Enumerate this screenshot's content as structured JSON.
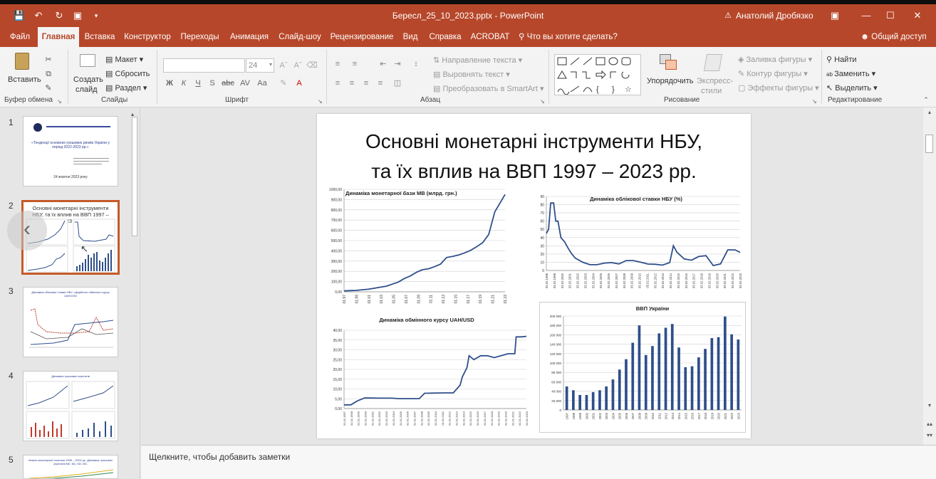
{
  "window": {
    "doc_title": "Бересл_25_10_2023.pptx - PowerPoint",
    "user": "Анатолий Дробязко"
  },
  "tabs": [
    {
      "label": "Файл"
    },
    {
      "label": "Главная"
    },
    {
      "label": "Вставка"
    },
    {
      "label": "Конструктор"
    },
    {
      "label": "Переходы"
    },
    {
      "label": "Анимация"
    },
    {
      "label": "Слайд-шоу"
    },
    {
      "label": "Рецензирование"
    },
    {
      "label": "Вид"
    },
    {
      "label": "Справка"
    },
    {
      "label": "ACROBAT"
    }
  ],
  "tell_me": "Что вы хотите сделать?",
  "share": "Общий доступ",
  "ribbon": {
    "clipboard": {
      "paste": "Вставить",
      "label": "Буфер обмена"
    },
    "slides": {
      "new_slide_1": "Создать",
      "new_slide_2": "слайд",
      "layout": "Макет",
      "reset": "Сбросить",
      "section": "Раздел",
      "label": "Слайды"
    },
    "font": {
      "font_name": "",
      "font_size": "24",
      "label": "Шрифт"
    },
    "paragraph": {
      "text_direction": "Направление текста",
      "align_text": "Выровнять текст",
      "smartart": "Преобразовать в SmartArt",
      "label": "Абзац"
    },
    "drawing": {
      "arrange_1": "Упорядочить",
      "styles_1": "Экспресс-",
      "styles_2": "стили",
      "fill": "Заливка фигуры",
      "outline": "Контур фигуры",
      "effects": "Эффекты фигуры",
      "label": "Рисование"
    },
    "editing": {
      "find": "Найти",
      "replace": "Заменить",
      "select": "Выделить",
      "label": "Редактирование"
    }
  },
  "slides_panel": [
    {
      "num": "1",
      "title": "«Тенденції основних грошових ринків України у період 2022-2023 рр.»",
      "date": "24 жовтня 2023 року"
    },
    {
      "num": "2",
      "title": "Основні монетарні інструменти НБУ, та їх вплив на ВВП 1997 – 2023 рр."
    },
    {
      "num": "3",
      "title": "Динаміка облікової ставки НБУ, офіційного обмінного курсу UAH/USD"
    },
    {
      "num": "4",
      "title": "Динаміка грошових агрегатів"
    },
    {
      "num": "5",
      "title": "Аналіз монетарної політики 1996 – 2023 рр. Динаміка грошових агрегатів M0, M1, M2, M3."
    }
  ],
  "slide": {
    "title_line1": "Основні монетарні інструменти НБУ,",
    "title_line2": "та їх вплив на ВВП 1997 – 2023 рр."
  },
  "notes_placeholder": "Щелкните, чтобы добавить заметки",
  "chart_data": [
    {
      "type": "line",
      "title": "Динаміка монетарної бази МВ (млрд. грн.)",
      "ylim": [
        0,
        1000
      ],
      "yticks": [
        "0,00",
        "100,00",
        "200,00",
        "300,00",
        "400,00",
        "500,00",
        "600,00",
        "700,00",
        "800,00",
        "900,00",
        "1000,00"
      ],
      "xticks": [
        "01.97",
        "01.99",
        "01.01",
        "01.03",
        "01.05",
        "01.07",
        "01.09",
        "01.11",
        "01.13",
        "01.15",
        "01.17",
        "01.19",
        "01.21",
        "01.23"
      ],
      "x": [
        1997,
        1998,
        1999,
        2000,
        2001,
        2002,
        2003,
        2004,
        2005,
        2006,
        2007,
        2008,
        2009,
        2010,
        2011,
        2012,
        2013,
        2014,
        2015,
        2016,
        2017,
        2018,
        2019,
        2020,
        2021,
        2022,
        2023,
        2023.7
      ],
      "y": [
        10,
        12,
        14,
        20,
        25,
        35,
        45,
        55,
        75,
        95,
        130,
        155,
        190,
        215,
        225,
        245,
        270,
        335,
        345,
        360,
        380,
        405,
        440,
        480,
        560,
        780,
        880,
        950
      ],
      "color": "#2f4f8a"
    },
    {
      "type": "line",
      "title": "Динаміка облікової ставки НБУ (%)",
      "ylim": [
        0,
        90
      ],
      "yticks": [
        "0",
        "10",
        "20",
        "30",
        "40",
        "50",
        "60",
        "70",
        "80",
        "90"
      ],
      "xticks": [
        "05.02.1998",
        "05.02.1999",
        "05.02.2000",
        "05.02.2001",
        "05.02.2002",
        "05.02.2003",
        "05.02.2004",
        "05.02.2005",
        "05.02.2006",
        "05.02.2007",
        "05.02.2008",
        "05.02.2009",
        "05.02.2010",
        "05.02.2011",
        "05.02.2012",
        "05.02.2013",
        "05.02.2014",
        "05.02.2015",
        "05.02.2016",
        "05.02.2017",
        "05.02.2018",
        "05.02.2019",
        "05.02.2020",
        "05.02.2021",
        "05.02.2022",
        "05.02.2023"
      ],
      "x": [
        1997,
        1997.3,
        1997.6,
        1998,
        1998.3,
        1998.6,
        1999,
        1999.5,
        2000,
        2000.5,
        2001,
        2002,
        2003,
        2004,
        2005,
        2006,
        2007,
        2008,
        2009,
        2010,
        2011,
        2012,
        2013,
        2014,
        2014.5,
        2015,
        2016,
        2017,
        2018,
        2019,
        2020,
        2021,
        2022,
        2023,
        2023.7
      ],
      "y": [
        45,
        50,
        82,
        82,
        60,
        60,
        40,
        35,
        27,
        20,
        15,
        10,
        7,
        7,
        9,
        9.5,
        8,
        12,
        12,
        10,
        7.75,
        7.5,
        6.5,
        9.5,
        30,
        22,
        14,
        12.5,
        17,
        18,
        6,
        8,
        25,
        25,
        22
      ],
      "color": "#2f4f8a"
    },
    {
      "type": "line",
      "title": "Динаміка обмінного курсу UAH/USD",
      "ylim": [
        0,
        40
      ],
      "yticks": [
        "0,00",
        "5,00",
        "10,00",
        "15,00",
        "20,00",
        "25,00",
        "30,00",
        "35,00",
        "40,00"
      ],
      "xticks": [
        "01.01.1997",
        "01.01.1998",
        "01.01.1999",
        "01.01.2000",
        "01.01.2001",
        "01.01.2002",
        "01.01.2003",
        "01.01.2004",
        "01.01.2005",
        "01.01.2006",
        "01.01.2007",
        "01.01.2008",
        "01.01.2009",
        "01.01.2010",
        "01.01.2011",
        "01.01.2012",
        "01.01.2013",
        "01.01.2014",
        "01.01.2015",
        "01.01.2016",
        "01.01.2017",
        "01.01.2018",
        "01.01.2019",
        "01.01.2020",
        "01.01.2021",
        "01.01.2022",
        "01.01.2023"
      ],
      "x": [
        1997,
        1998,
        1998.7,
        1999,
        2000,
        2001,
        2002,
        2003,
        2004,
        2005,
        2006,
        2007,
        2008,
        2008.8,
        2009,
        2010,
        2011,
        2012,
        2013,
        2014,
        2014.3,
        2015,
        2015.3,
        2016,
        2017,
        2018,
        2019,
        2020,
        2021,
        2022,
        2022.2,
        2023,
        2023.7
      ],
      "y": [
        1.9,
        1.9,
        3.4,
        4,
        5.4,
        5.4,
        5.3,
        5.3,
        5.3,
        5.05,
        5.05,
        5.05,
        5.05,
        7.8,
        7.8,
        7.9,
        7.95,
        8,
        8,
        12,
        16,
        21,
        27,
        25,
        27,
        27,
        26,
        27,
        28,
        28,
        36.6,
        36.6,
        36.9
      ],
      "color": "#2f4f8a"
    },
    {
      "type": "bar",
      "title": "ВВП України",
      "ylim": [
        0,
        200000
      ],
      "yticks": [
        "0",
        "20 000",
        "40 000",
        "60 000",
        "80 000",
        "100 000",
        "120 000",
        "140 000",
        "160 000",
        "180 000",
        "200 000"
      ],
      "categories": [
        "1997",
        "1998",
        "1999",
        "2000",
        "2001",
        "2002",
        "2003",
        "2004",
        "2005",
        "2006",
        "2007",
        "2008",
        "2009",
        "2010",
        "2011",
        "2012",
        "2013",
        "2014",
        "2015",
        "2016",
        "2017",
        "2018",
        "2019",
        "2020",
        "2021",
        "2022",
        "2023"
      ],
      "values": [
        50000,
        42000,
        32000,
        32000,
        38000,
        42000,
        50000,
        65000,
        86000,
        108000,
        143000,
        180000,
        117000,
        136000,
        163000,
        175000,
        183000,
        133000,
        91000,
        93000,
        112000,
        130000,
        153000,
        155000,
        199000,
        161000,
        150000
      ],
      "color": "#2f4f8a"
    }
  ]
}
